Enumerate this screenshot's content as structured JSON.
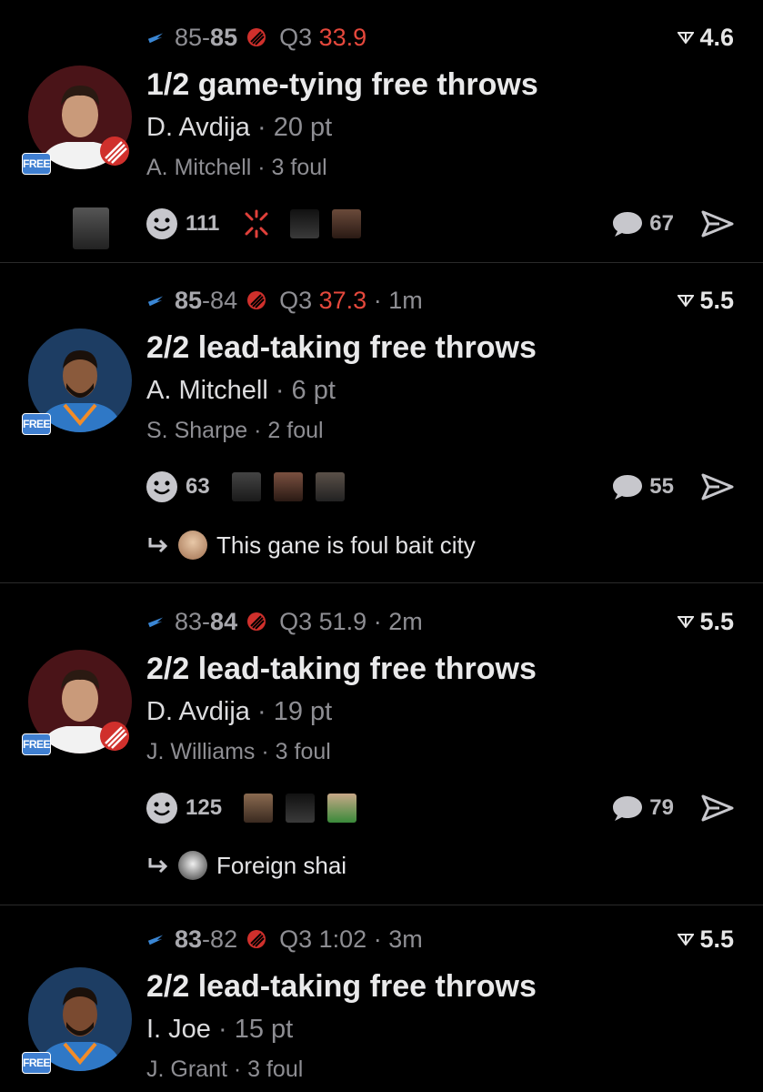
{
  "colors": {
    "background": "#000000",
    "clock_red": "#e5483c",
    "free_badge": "#3f7fd1",
    "muted": "#8e8e93"
  },
  "plays": [
    {
      "score_left": "85",
      "score_sep": "-",
      "score_right": "85",
      "quarter": "Q3",
      "clock": "33.9",
      "ago": "",
      "line": "4.6",
      "title": "1/2 game-tying free throws",
      "player": "D. Avdija",
      "player_stat": "· 20 pt",
      "fouler": "A. Mitchell · 3 foul",
      "badge": "FREE",
      "team": "blazers",
      "reaction_count": "111",
      "comment_count": "67",
      "reply_text": ""
    },
    {
      "score_left": "85",
      "score_sep": "-",
      "score_right": "84",
      "quarter": "Q3",
      "clock": "37.3",
      "ago": "· 1m",
      "line": "5.5",
      "title": "2/2 lead-taking free throws",
      "player": "A. Mitchell",
      "player_stat": "· 6 pt",
      "fouler": "S. Sharpe · 2 foul",
      "badge": "FREE",
      "team": "thunder",
      "reaction_count": "63",
      "comment_count": "55",
      "reply_text": "This gane is foul bait city"
    },
    {
      "score_left": "83",
      "score_sep": "-",
      "score_right": "84",
      "quarter": "Q3",
      "clock": "51.9",
      "ago": "· 2m",
      "line": "5.5",
      "title": "2/2 lead-taking free throws",
      "player": "D. Avdija",
      "player_stat": "· 19 pt",
      "fouler": "J. Williams · 3 foul",
      "badge": "FREE",
      "team": "blazers",
      "reaction_count": "125",
      "comment_count": "79",
      "reply_text": "Foreign shai"
    },
    {
      "score_left": "83",
      "score_sep": "-",
      "score_right": "82",
      "quarter": "Q3",
      "clock": "1:02",
      "ago": "· 3m",
      "line": "5.5",
      "title": "2/2 lead-taking free throws",
      "player": "I. Joe",
      "player_stat": "· 15 pt",
      "fouler": "J. Grant · 3 foul",
      "badge": "FREE",
      "team": "thunder",
      "reaction_count": "",
      "comment_count": "",
      "reply_text": ""
    }
  ]
}
